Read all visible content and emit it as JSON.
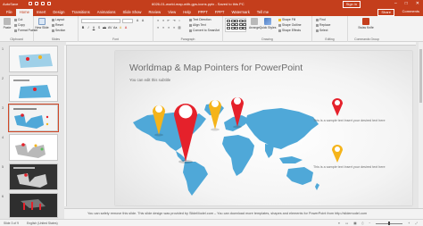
{
  "titlebar": {
    "autosave": "AutoSave",
    "doc_title": "6026-01-world-map-with-gps-icons.pptx  -  Saved to this PC",
    "sign_in": "Sign in",
    "minimize": "–",
    "maximize": "□",
    "close": "✕",
    "color": "#c43e1c"
  },
  "tabs": [
    {
      "label": "File"
    },
    {
      "label": "Home",
      "active": true
    },
    {
      "label": "Insert"
    },
    {
      "label": "Design"
    },
    {
      "label": "Transitions"
    },
    {
      "label": "Animations"
    },
    {
      "label": "Slide Show"
    },
    {
      "label": "Review"
    },
    {
      "label": "View"
    },
    {
      "label": "Help"
    },
    {
      "label": "PPPT"
    },
    {
      "label": "FPPT"
    },
    {
      "label": "Watermark"
    },
    {
      "label": "Tell me"
    }
  ],
  "tabrow": {
    "share": "Share",
    "comments": "Comments"
  },
  "ribbon": {
    "clipboard": {
      "label": "Clipboard",
      "paste": "Paste",
      "cut": "Cut",
      "copy": "Copy",
      "format_painter": "Format Painter"
    },
    "slides": {
      "label": "Slides",
      "new_slide": "New Slide",
      "layout": "Layout",
      "reset": "Reset",
      "section": "Section"
    },
    "font": {
      "label": "Font"
    },
    "paragraph": {
      "label": "Paragraph",
      "text_direction": "Text Direction",
      "align_text": "Align Text",
      "convert_smartart": "Convert to SmartArt"
    },
    "drawing": {
      "label": "Drawing",
      "arrange": "Arrange",
      "quick_styles": "Quick Styles",
      "shape_fill": "Shape Fill",
      "shape_outline": "Shape Outline",
      "shape_effects": "Shape Effects"
    },
    "editing": {
      "label": "Editing",
      "find": "Find",
      "replace": "Replace",
      "select": "Select"
    },
    "commands": {
      "label": "Commands Group",
      "swiss": "Swiss Knife"
    }
  },
  "thumbnails": [
    {
      "num": "1"
    },
    {
      "num": "2"
    },
    {
      "num": "3",
      "selected": true
    },
    {
      "num": "4"
    },
    {
      "num": "5"
    },
    {
      "num": "6"
    }
  ],
  "slide": {
    "title": "Worldmap & Map Pointers for PowerPoint",
    "subtitle": "You can edit this subtitle",
    "pin_text_1": "This is a sample text Insert your desired text here",
    "pin_text_2": "This is a sample text Insert your desired text here",
    "map_color": "#4fa8d8",
    "pin_red": "#e5212b",
    "pin_yellow": "#f5b41a"
  },
  "notes": {
    "text": "You can safely remove this slide. This slide design was provided by SlideModel.com – You can download more templates, shapes and elements for PowerPoint from http://slidemodel.com"
  },
  "status": {
    "slide_count": "Slide 3 of 9",
    "language": "English (United States)"
  }
}
